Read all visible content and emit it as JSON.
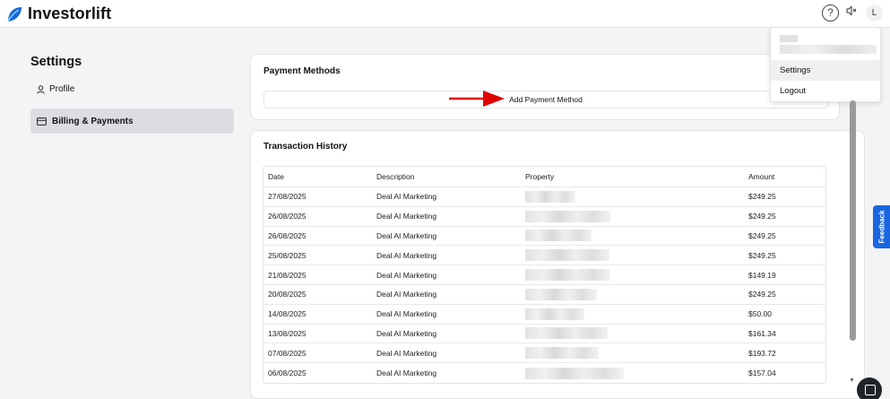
{
  "app": {
    "brand": "Investorlift",
    "brand_color": "#1a66e0"
  },
  "header": {
    "help_icon": "help-circle-icon",
    "mute_icon": "speaker-mute-icon",
    "avatar_initial": "L"
  },
  "sidebar": {
    "title": "Settings",
    "items": [
      {
        "label": "Profile",
        "icon": "user-icon",
        "active": false
      },
      {
        "label": "Billing & Payments",
        "icon": "credit-card-icon",
        "active": true
      }
    ]
  },
  "payment_methods": {
    "title": "Payment Methods",
    "add_label": "Add Payment Method"
  },
  "transactions": {
    "title": "Transaction History",
    "columns": [
      "Date",
      "Description",
      "Property",
      "Amount"
    ],
    "rows": [
      {
        "date": "27/08/2025",
        "description": "Deal AI Marketing",
        "amount": "$249.25"
      },
      {
        "date": "26/08/2025",
        "description": "Deal AI Marketing",
        "amount": "$249.25"
      },
      {
        "date": "26/08/2025",
        "description": "Deal AI Marketing",
        "amount": "$249.25"
      },
      {
        "date": "25/08/2025",
        "description": "Deal AI Marketing",
        "amount": "$249.25"
      },
      {
        "date": "21/08/2025",
        "description": "Deal AI Marketing",
        "amount": "$149.19"
      },
      {
        "date": "20/08/2025",
        "description": "Deal AI Marketing",
        "amount": "$249.25"
      },
      {
        "date": "14/08/2025",
        "description": "Deal AI Marketing",
        "amount": "$50.00"
      },
      {
        "date": "13/08/2025",
        "description": "Deal AI Marketing",
        "amount": "$161.34"
      },
      {
        "date": "07/08/2025",
        "description": "Deal AI Marketing",
        "amount": "$193.72"
      },
      {
        "date": "06/08/2025",
        "description": "Deal AI Marketing",
        "amount": "$157.04"
      }
    ]
  },
  "account_menu": {
    "items": [
      "Settings",
      "Logout"
    ]
  },
  "feedback": {
    "label": "Feedback"
  }
}
